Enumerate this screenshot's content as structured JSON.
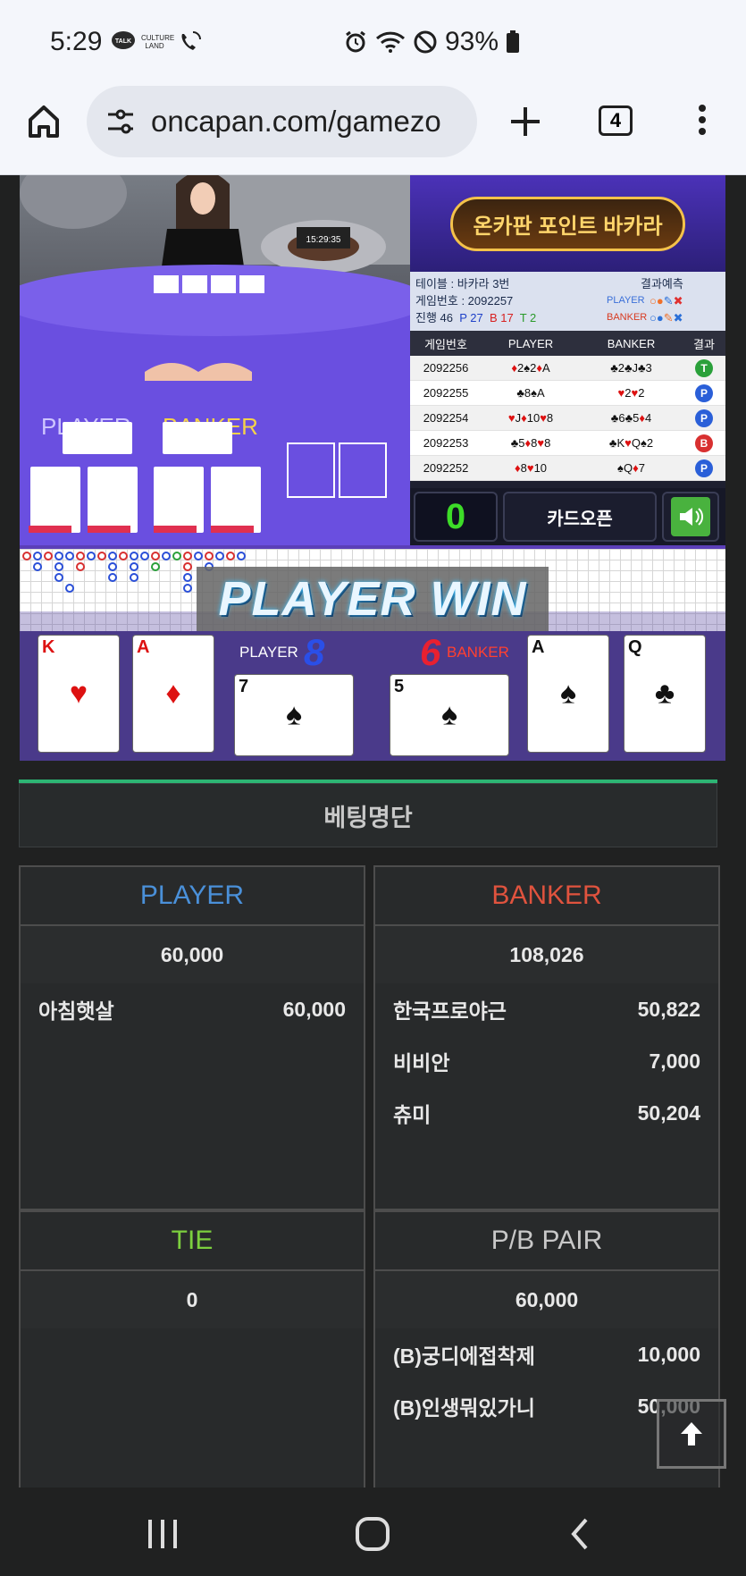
{
  "status_bar": {
    "time": "5:29",
    "battery": "93%",
    "notif_talk": "TALK",
    "notif_culture": "CULTURE LAND"
  },
  "browser": {
    "url": "oncapan.com/gamezo",
    "tab_count": "4"
  },
  "game_panel": {
    "banner_text": "온카판 포인트 바카라",
    "table_label": "테이블 : 바카라 3번",
    "result_predict_label": "결과예측",
    "game_no_label": "게임번호 : 2092257",
    "progress": {
      "label": "진행 46",
      "p": "P 27",
      "b": "B 17",
      "t": "T 2"
    },
    "predict_player": "PLAYER",
    "predict_banker": "BANKER",
    "history_headers": [
      "게임번호",
      "PLAYER",
      "BANKER",
      "결과"
    ],
    "history": [
      {
        "no": "2092256",
        "player": "♦2♠2♦A",
        "banker": "♣2♣J♣3",
        "result": "T"
      },
      {
        "no": "2092255",
        "player": "♣8♠A",
        "banker": "♥2♥2",
        "result": "P"
      },
      {
        "no": "2092254",
        "player": "♥J♦10♥8",
        "banker": "♣6♣5♦4",
        "result": "P"
      },
      {
        "no": "2092253",
        "player": "♣5♦8♥8",
        "banker": "♣K♥Q♠2",
        "result": "B"
      },
      {
        "no": "2092252",
        "player": "♦8♥10",
        "banker": "♠Q♦7",
        "result": "P"
      }
    ],
    "count_value": "0",
    "card_open_label": "카드오픈",
    "win_text": "PLAYER WIN",
    "player_label": "PLAYER",
    "player_score": "8",
    "banker_label": "BANKER",
    "banker_score": "6",
    "clock": "15:29:35",
    "table_player": "PLAYER",
    "table_banker": "BANKER",
    "cards": [
      {
        "rank": "K",
        "suit": "♥",
        "color": "#d11"
      },
      {
        "rank": "A",
        "suit": "♦",
        "color": "#d11"
      },
      {
        "rank": "7",
        "suit": "♠",
        "color": "#111"
      },
      {
        "rank": "5",
        "suit": "♠",
        "color": "#111"
      },
      {
        "rank": "A",
        "suit": "♠",
        "color": "#111"
      },
      {
        "rank": "Q",
        "suit": "♣",
        "color": "#111"
      }
    ]
  },
  "betting": {
    "title": "베팅명단",
    "player": {
      "header": "PLAYER",
      "color": "#4a90d9",
      "total": "60,000",
      "rows": [
        {
          "name": "아침햇살",
          "amount": "60,000"
        }
      ]
    },
    "banker": {
      "header": "BANKER",
      "color": "#e0533e",
      "total": "108,026",
      "rows": [
        {
          "name": "한국프로야근",
          "amount": "50,822"
        },
        {
          "name": "비비안",
          "amount": "7,000"
        },
        {
          "name": "츄미",
          "amount": "50,204"
        }
      ]
    },
    "tie": {
      "header": "TIE",
      "color": "#7ccf3e",
      "total": "0",
      "rows": []
    },
    "pair": {
      "header": "P/B PAIR",
      "color": "#c8c8c8",
      "total": "60,000",
      "rows": [
        {
          "name": "(B)궁디에접착제",
          "amount": "10,000"
        },
        {
          "name": "(B)인생뭐있가니",
          "amount": "50,000"
        }
      ]
    }
  }
}
